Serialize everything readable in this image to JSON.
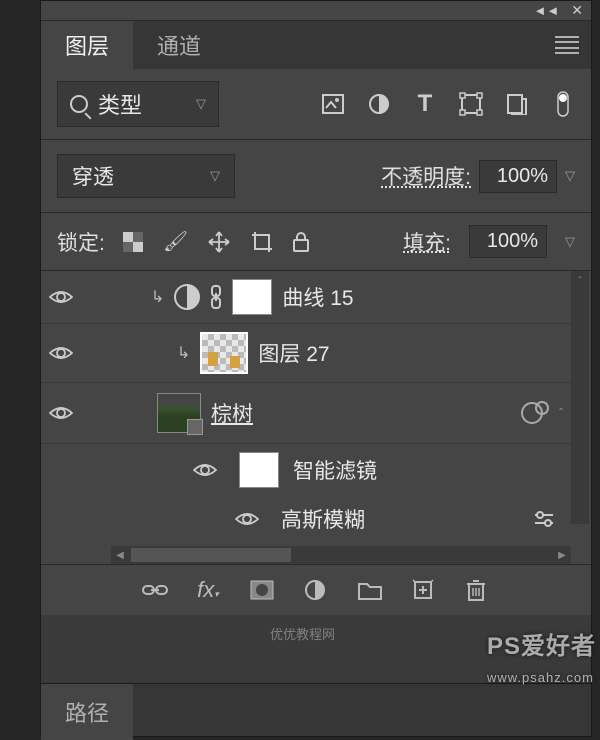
{
  "tabs": {
    "layers": "图层",
    "channels": "通道"
  },
  "filter": {
    "type_label": "类型"
  },
  "blend": {
    "mode": "穿透",
    "opacity_label": "不透明度:",
    "opacity_value": "100%"
  },
  "lock": {
    "label": "锁定:",
    "fill_label": "填充:",
    "fill_value": "100%"
  },
  "layers": {
    "curves": "曲线 15",
    "layer27": "图层 27",
    "palm": "棕树",
    "smart_filters": "智能滤镜",
    "gaussian_blur": "高斯模糊"
  },
  "paths_tab": "路径",
  "watermark": "PS爱好者",
  "watermark_url": "www.psahz.com",
  "watermark2": "优优教程网"
}
